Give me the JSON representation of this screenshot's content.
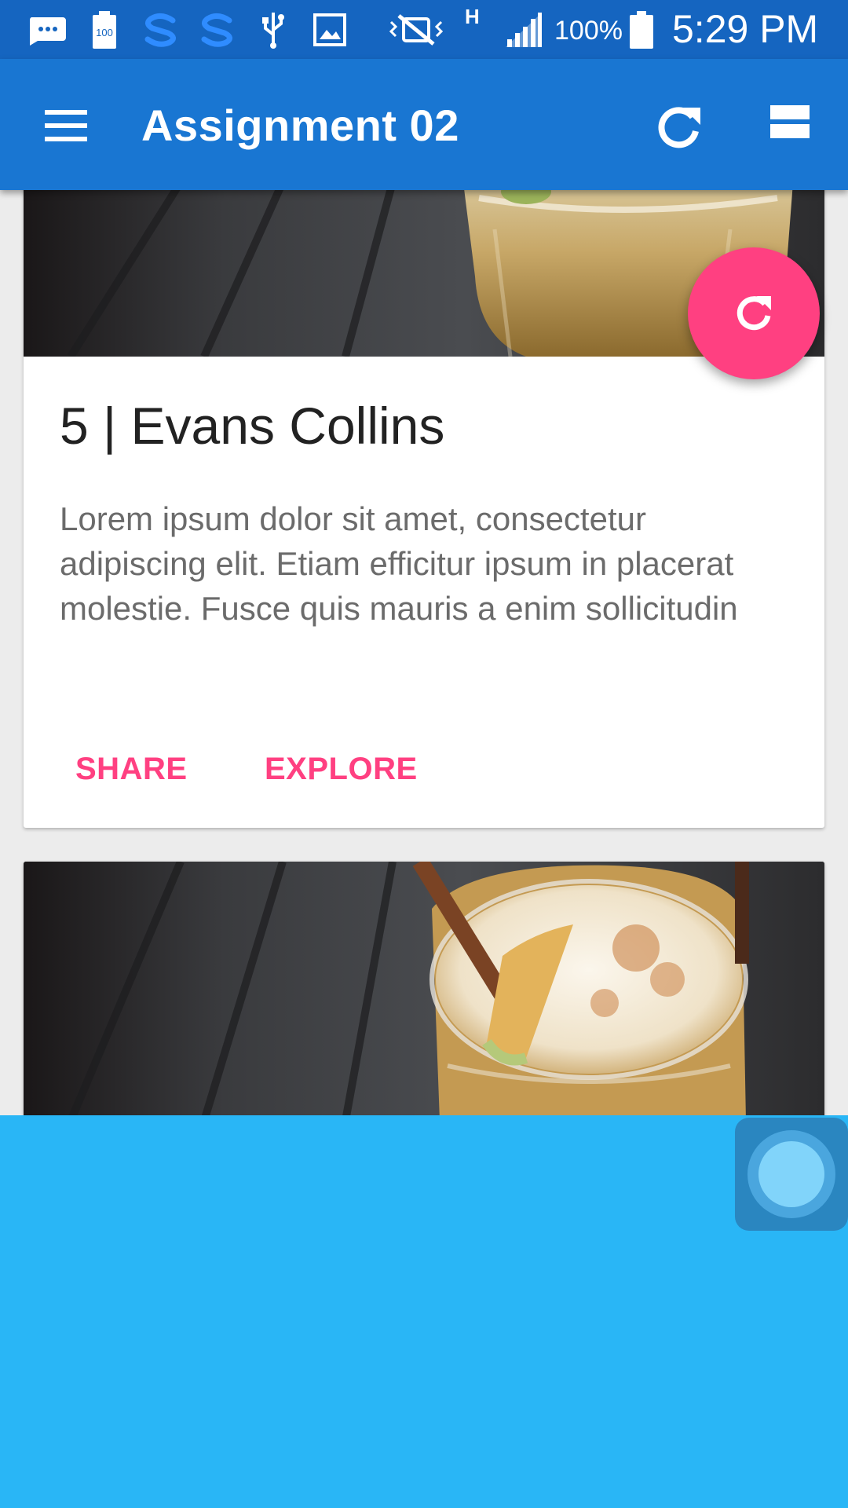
{
  "status_bar": {
    "battery_percent": "100%",
    "time": "5:29 PM",
    "network_type": "H",
    "icons": [
      "messaging-icon",
      "battery-saver-icon",
      "s-app-icon",
      "s-app-icon",
      "usb-icon",
      "gallery-icon",
      "mute-vibrate-icon",
      "signal-icon",
      "battery-icon"
    ]
  },
  "app_bar": {
    "title": "Assignment 02",
    "menu_icon": "hamburger-menu-icon",
    "refresh_icon": "refresh-icon",
    "view_icon": "view-stream-icon"
  },
  "cards": [
    {
      "title": "5 | Evans Collins",
      "body": "Lorem ipsum dolor sit amet, consectetur adipiscing elit. Etiam efficitur ipsum in placerat molestie. Fusce quis mauris a enim sollicitudin",
      "actions": [
        "SHARE",
        "EXPLORE"
      ]
    },
    {
      "title": "",
      "body": "",
      "actions": []
    }
  ],
  "fab": {
    "icon": "refresh-icon"
  },
  "colors": {
    "status_bar": "#1565c0",
    "app_bar": "#1976d2",
    "accent": "#ff4081",
    "bottom_panel": "#29b6f6"
  }
}
